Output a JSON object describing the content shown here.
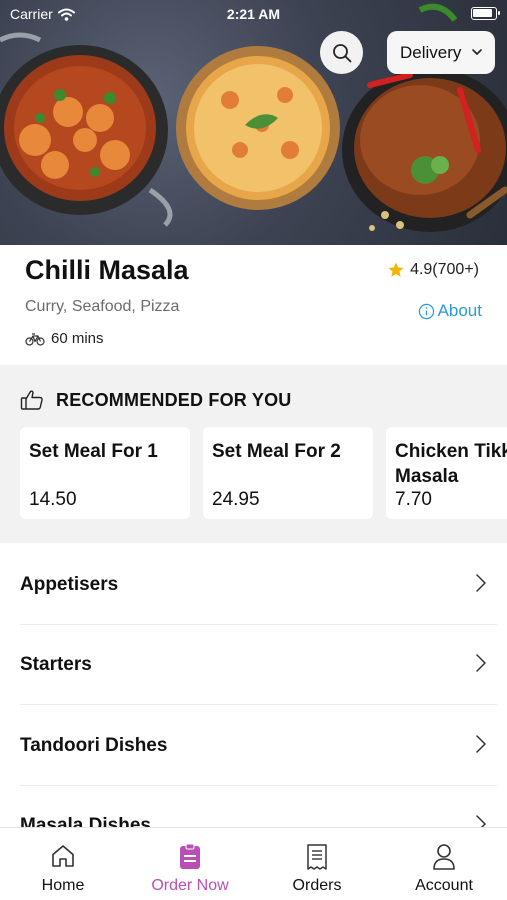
{
  "status_bar": {
    "carrier": "Carrier",
    "time": "2:21 AM"
  },
  "header": {
    "delivery_mode": "Delivery"
  },
  "restaurant": {
    "name": "Chilli Masala",
    "rating": "4.9(700+)",
    "cuisine": "Curry, Seafood, Pizza",
    "about_label": "About",
    "delivery_time": "60 mins"
  },
  "recommended": {
    "title": "RECOMMENDED FOR YOU",
    "items": [
      {
        "name": "Set Meal For 1",
        "price": "14.50"
      },
      {
        "name": "Set Meal For 2",
        "price": "24.95"
      },
      {
        "name": "Chicken Tikka Masala",
        "price": "7.70"
      }
    ]
  },
  "categories": [
    "Appetisers",
    "Starters",
    "Tandoori Dishes",
    "Masala Dishes"
  ],
  "tabs": [
    {
      "label": "Home",
      "icon": "home-icon"
    },
    {
      "label": "Order Now",
      "icon": "order-icon"
    },
    {
      "label": "Orders",
      "icon": "receipt-icon"
    },
    {
      "label": "Account",
      "icon": "person-icon"
    }
  ],
  "colors": {
    "accent": "#b94fb4",
    "link": "#2a9bd6",
    "star": "#f5b400"
  }
}
